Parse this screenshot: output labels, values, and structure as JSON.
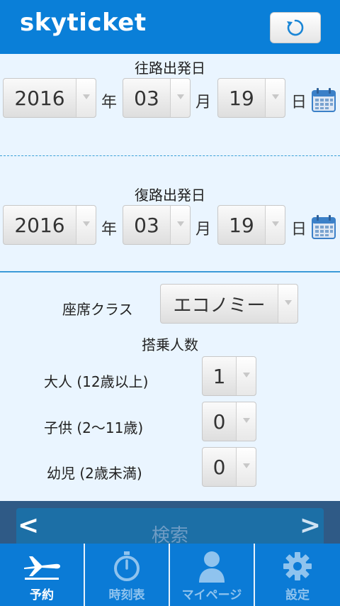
{
  "header": {
    "logo": "skyticket",
    "refresh_icon": "refresh-icon"
  },
  "outbound": {
    "label": "往路出発日",
    "year": "2016",
    "year_unit": "年",
    "month": "03",
    "month_unit": "月",
    "day": "19",
    "day_unit": "日"
  },
  "return": {
    "label": "復路出発日",
    "year": "2016",
    "year_unit": "年",
    "month": "03",
    "month_unit": "月",
    "day": "19",
    "day_unit": "日"
  },
  "seat": {
    "label": "座席クラス",
    "value": "エコノミー"
  },
  "passengers": {
    "title": "搭乗人数",
    "adult": {
      "label": "大人 (12歳以上)",
      "value": "1"
    },
    "child": {
      "label": "子供 (2〜11歳)",
      "value": "0"
    },
    "infant": {
      "label": "幼児 (2歳未満)",
      "value": "0"
    }
  },
  "search": {
    "label": "検索",
    "prev": "<",
    "next": ">"
  },
  "tabs": [
    {
      "label": "予約",
      "icon": "airplane-icon",
      "active": true
    },
    {
      "label": "時刻表",
      "icon": "stopwatch-icon",
      "active": false
    },
    {
      "label": "マイページ",
      "icon": "person-icon",
      "active": false
    },
    {
      "label": "設定",
      "icon": "gear-icon",
      "active": false
    }
  ],
  "colors": {
    "brand": "#0a7fd8",
    "background": "#eaf5ff",
    "search_bar": "#2f5a86"
  }
}
